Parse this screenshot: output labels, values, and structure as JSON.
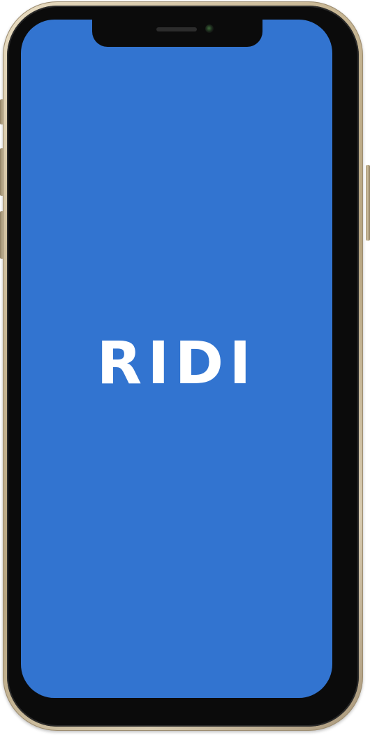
{
  "splash": {
    "logo_text": "RIDI",
    "background_color": "#3274d0"
  },
  "device": {
    "frame_color": "#c9b896"
  }
}
